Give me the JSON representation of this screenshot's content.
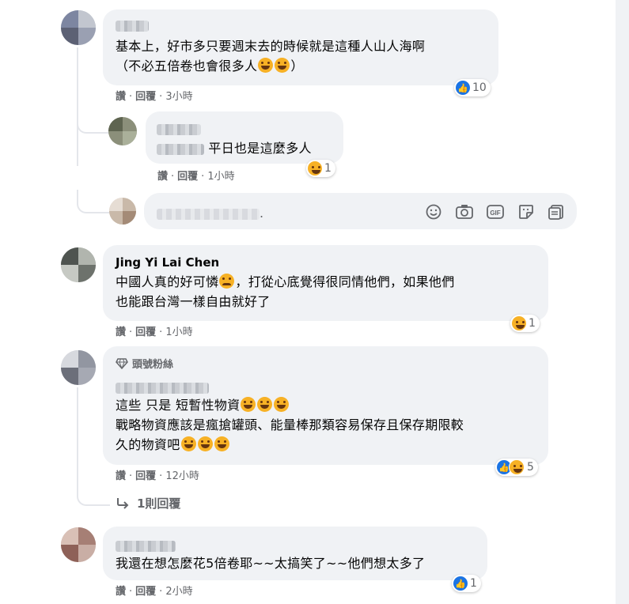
{
  "comments": [
    {
      "author_hidden": true,
      "lines": [
        "基本上，好市多只要週末去的時候就是這種人山人海啊",
        "（不必五倍卷也會很多人",
        "）"
      ],
      "actions": {
        "like": "讚",
        "reply": "回覆",
        "time": "3小時"
      },
      "reaction_count": "10"
    },
    {
      "author_hidden": true,
      "text": "平日也是這麼多人",
      "actions": {
        "like": "讚",
        "reply": "回覆",
        "time": "1小時"
      },
      "reaction_count": "1"
    },
    {
      "author": "Jing Yi Lai Chen",
      "lines": [
        "中國人真的好可憐",
        "，打從心底覺得很同情他們，如果他們",
        "也能跟台灣一樣自由就好了"
      ],
      "actions": {
        "like": "讚",
        "reply": "回覆",
        "time": "1小時"
      },
      "reaction_count": "1"
    },
    {
      "badge": "頭號粉絲",
      "lines": [
        "這些 只是 短暫性物資",
        "戰略物資應該是瘋搶罐頭、能量棒那類容易保存且保存期限較",
        "久的物資吧"
      ],
      "actions": {
        "like": "讚",
        "reply": "回覆",
        "time": "12小時"
      },
      "reaction_count": "5",
      "replies_link": "1則回覆"
    },
    {
      "text": "我還在想怎麼花5倍卷耶~~太搞笑了~~他們想太多了",
      "actions": {
        "like": "讚",
        "reply": "回覆",
        "time": "2小時"
      },
      "reaction_count": "1"
    }
  ],
  "reply_box": {
    "placeholder_blurred": true,
    "tools": [
      "emoji-icon",
      "camera-icon",
      "gif-icon",
      "sticker-icon",
      "more-stickers-icon"
    ]
  },
  "colors": {
    "bubble": "#f0f2f5",
    "meta": "#65676b",
    "like": "#1b74e4",
    "haha": "#f7b125"
  }
}
